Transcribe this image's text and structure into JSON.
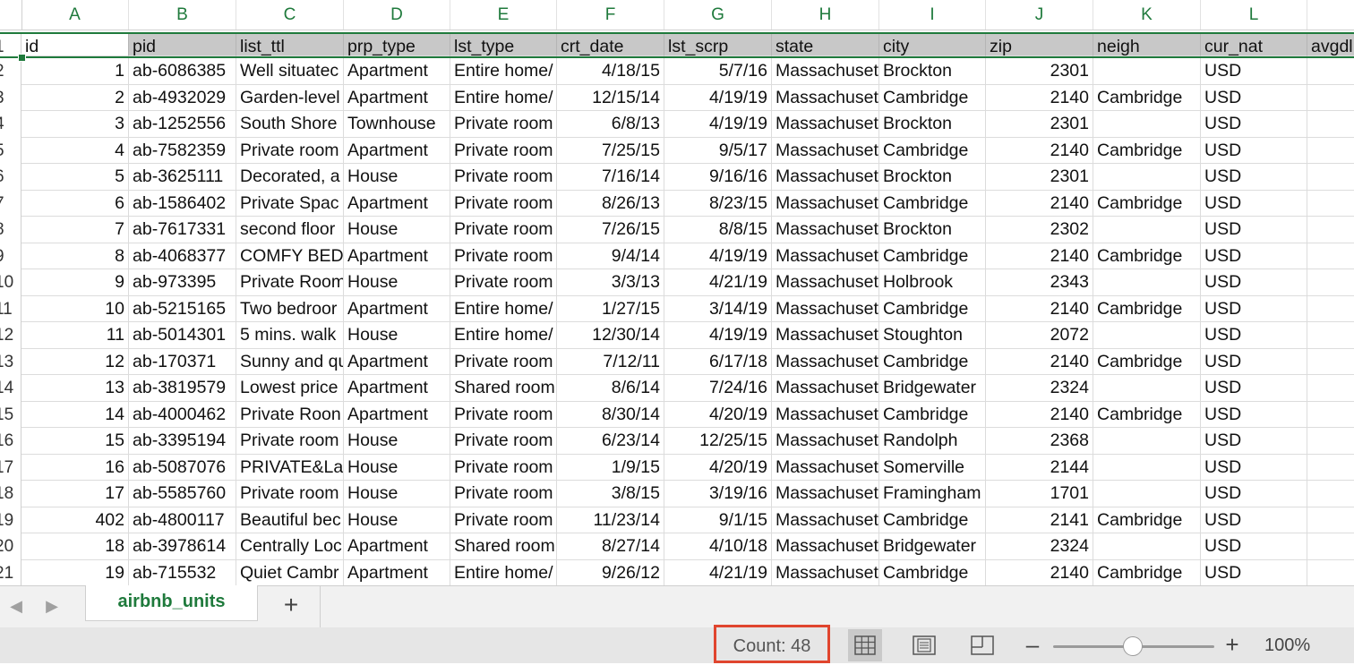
{
  "columns": [
    "A",
    "B",
    "C",
    "D",
    "E",
    "F",
    "G",
    "H",
    "I",
    "J",
    "K",
    "L"
  ],
  "header_row": {
    "row_number": "1",
    "cells": [
      "id",
      "pid",
      "list_ttl",
      "prp_type",
      "lst_type",
      "crt_date",
      "lst_scrp",
      "state",
      "city",
      "zip",
      "neigh",
      "cur_nat",
      "avgdl"
    ]
  },
  "rows": [
    {
      "n": "2",
      "c": [
        "1",
        "ab-6086385",
        "Well situatec",
        "Apartment",
        "Entire home/",
        "4/18/15",
        "5/7/16",
        "Massachuset",
        "Brockton",
        "2301",
        "",
        "USD"
      ]
    },
    {
      "n": "3",
      "c": [
        "2",
        "ab-4932029",
        "Garden-level",
        "Apartment",
        "Entire home/",
        "12/15/14",
        "4/19/19",
        "Massachuset",
        "Cambridge",
        "2140",
        "Cambridge",
        "USD"
      ]
    },
    {
      "n": "4",
      "c": [
        "3",
        "ab-1252556",
        "South Shore",
        "Townhouse",
        "Private room",
        "6/8/13",
        "4/19/19",
        "Massachuset",
        "Brockton",
        "2301",
        "",
        "USD"
      ]
    },
    {
      "n": "5",
      "c": [
        "4",
        "ab-7582359",
        "Private room",
        "Apartment",
        "Private room",
        "7/25/15",
        "9/5/17",
        "Massachuset",
        "Cambridge",
        "2140",
        "Cambridge",
        "USD"
      ]
    },
    {
      "n": "6",
      "c": [
        "5",
        "ab-3625111",
        "Decorated, a",
        "House",
        "Private room",
        "7/16/14",
        "9/16/16",
        "Massachuset",
        "Brockton",
        "2301",
        "",
        "USD"
      ]
    },
    {
      "n": "7",
      "c": [
        "6",
        "ab-1586402",
        "Private Spac",
        "Apartment",
        "Private room",
        "8/26/13",
        "8/23/15",
        "Massachuset",
        "Cambridge",
        "2140",
        "Cambridge",
        "USD"
      ]
    },
    {
      "n": "8",
      "c": [
        "7",
        "ab-7617331",
        "second floor",
        "House",
        "Private room",
        "7/26/15",
        "8/8/15",
        "Massachuset",
        "Brockton",
        "2302",
        "",
        "USD"
      ]
    },
    {
      "n": "9",
      "c": [
        "8",
        "ab-4068377",
        "COMFY BED",
        "Apartment",
        "Private room",
        "9/4/14",
        "4/19/19",
        "Massachuset",
        "Cambridge",
        "2140",
        "Cambridge",
        "USD"
      ]
    },
    {
      "n": "10",
      "c": [
        "9",
        "ab-973395",
        "Private Room",
        "House",
        "Private room",
        "3/3/13",
        "4/21/19",
        "Massachuset",
        "Holbrook",
        "2343",
        "",
        "USD"
      ]
    },
    {
      "n": "11",
      "c": [
        "10",
        "ab-5215165",
        "Two bedroor",
        "Apartment",
        "Entire home/",
        "1/27/15",
        "3/14/19",
        "Massachuset",
        "Cambridge",
        "2140",
        "Cambridge",
        "USD"
      ]
    },
    {
      "n": "12",
      "c": [
        "11",
        "ab-5014301",
        "5 mins. walk",
        "House",
        "Entire home/",
        "12/30/14",
        "4/19/19",
        "Massachuset",
        "Stoughton",
        "2072",
        "",
        "USD"
      ]
    },
    {
      "n": "13",
      "c": [
        "12",
        "ab-170371",
        "Sunny and qu",
        "Apartment",
        "Private room",
        "7/12/11",
        "6/17/18",
        "Massachuset",
        "Cambridge",
        "2140",
        "Cambridge",
        "USD"
      ]
    },
    {
      "n": "14",
      "c": [
        "13",
        "ab-3819579",
        "Lowest price",
        "Apartment",
        "Shared room",
        "8/6/14",
        "7/24/16",
        "Massachuset",
        "Bridgewater",
        "2324",
        "",
        "USD"
      ]
    },
    {
      "n": "15",
      "c": [
        "14",
        "ab-4000462",
        "Private Roon",
        "Apartment",
        "Private room",
        "8/30/14",
        "4/20/19",
        "Massachuset",
        "Cambridge",
        "2140",
        "Cambridge",
        "USD"
      ]
    },
    {
      "n": "16",
      "c": [
        "15",
        "ab-3395194",
        "Private room",
        "House",
        "Private room",
        "6/23/14",
        "12/25/15",
        "Massachuset",
        "Randolph",
        "2368",
        "",
        "USD"
      ]
    },
    {
      "n": "17",
      "c": [
        "16",
        "ab-5087076",
        "PRIVATE&La",
        "House",
        "Private room",
        "1/9/15",
        "4/20/19",
        "Massachuset",
        "Somerville",
        "2144",
        "",
        "USD"
      ]
    },
    {
      "n": "18",
      "c": [
        "17",
        "ab-5585760",
        "Private room",
        "House",
        "Private room",
        "3/8/15",
        "3/19/16",
        "Massachuset",
        "Framingham",
        "1701",
        "",
        "USD"
      ]
    },
    {
      "n": "19",
      "c": [
        "402",
        "ab-4800117",
        "Beautiful bec",
        "House",
        "Private room",
        "11/23/14",
        "9/1/15",
        "Massachuset",
        "Cambridge",
        "2141",
        "Cambridge",
        "USD"
      ]
    },
    {
      "n": "20",
      "c": [
        "18",
        "ab-3978614",
        "Centrally Loc",
        "Apartment",
        "Shared room",
        "8/27/14",
        "4/10/18",
        "Massachuset",
        "Bridgewater",
        "2324",
        "",
        "USD"
      ]
    },
    {
      "n": "21",
      "c": [
        "19",
        "ab-715532",
        "Quiet Cambr",
        "Apartment",
        "Entire home/",
        "9/26/12",
        "4/21/19",
        "Massachuset",
        "Cambridge",
        "2140",
        "Cambridge",
        "USD"
      ]
    }
  ],
  "sheet_tab": "airbnb_units",
  "add_sheet_label": "+",
  "status": {
    "count": "Count: 48",
    "zoom": "100%",
    "zoom_value_percent": 100
  },
  "colors": {
    "accent": "#1f7a3c",
    "highlight_box": "#e0452e"
  }
}
